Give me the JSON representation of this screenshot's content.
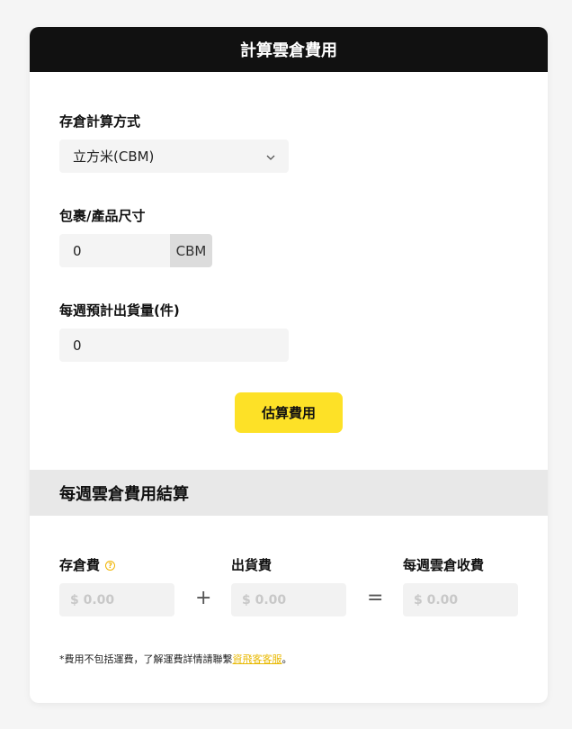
{
  "header": {
    "title": "計算雲倉費用"
  },
  "form": {
    "method_label": "存倉計算方式",
    "method_value": "立方米(CBM)",
    "size_label": "包裹/產品尺寸",
    "size_value": "0",
    "size_unit": "CBM",
    "quantity_label": "每週預計出貨量(件)",
    "quantity_value": "0",
    "submit_label": "估算費用"
  },
  "summary": {
    "title": "每週雲倉費用結算",
    "storage_label": "存倉費",
    "storage_value": "$ 0.00",
    "plus": "+",
    "shipping_label": "出貨費",
    "shipping_value": "$ 0.00",
    "equals": "=",
    "total_label": "每週雲倉收費",
    "total_value": "$ 0.00"
  },
  "note": {
    "text_before": "*費用不包括運費，了解運費詳情請聯繫",
    "link": "資飛客客服",
    "text_after": "。"
  },
  "colors": {
    "accent": "#fde127",
    "header_bg": "#111111",
    "info_icon": "#f0b400"
  }
}
